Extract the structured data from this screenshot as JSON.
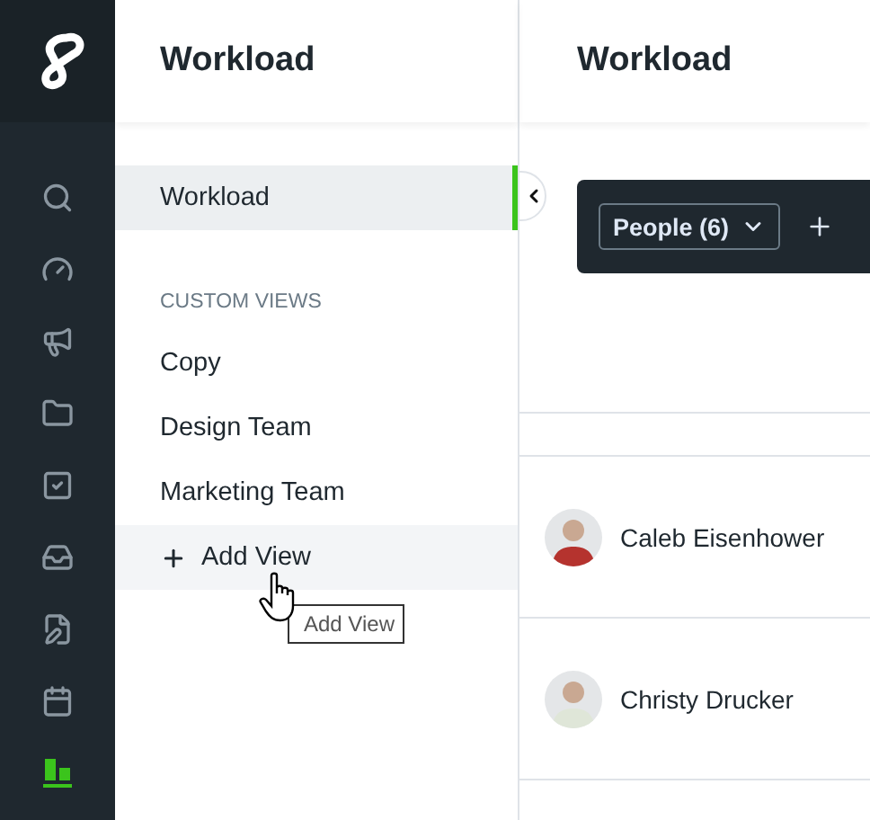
{
  "rail": {
    "items": [
      {
        "kind": "search",
        "selected": false
      },
      {
        "kind": "gauge",
        "selected": false
      },
      {
        "kind": "megaphone",
        "selected": false
      },
      {
        "kind": "folder",
        "selected": false
      },
      {
        "kind": "task",
        "selected": false
      },
      {
        "kind": "inbox",
        "selected": false
      },
      {
        "kind": "file-edit",
        "selected": false
      },
      {
        "kind": "calendar",
        "selected": false
      },
      {
        "kind": "workload",
        "selected": true
      }
    ]
  },
  "sidebar": {
    "title": "Workload",
    "items": [
      {
        "label": "Workload",
        "selected": true
      }
    ],
    "section_heading": "CUSTOM VIEWS",
    "custom_views": [
      {
        "label": "Copy",
        "hovered": false
      },
      {
        "label": "Design Team",
        "hovered": false
      },
      {
        "label": "Marketing Team",
        "hovered": false
      }
    ],
    "add_view": {
      "label": "Add View",
      "hovered": true
    },
    "tooltip": "Add View"
  },
  "main": {
    "title": "Workload",
    "people_filter": "People (6)",
    "rows": [
      {
        "name": "Caleb Eisenhower"
      },
      {
        "name": "Christy Drucker"
      }
    ]
  }
}
